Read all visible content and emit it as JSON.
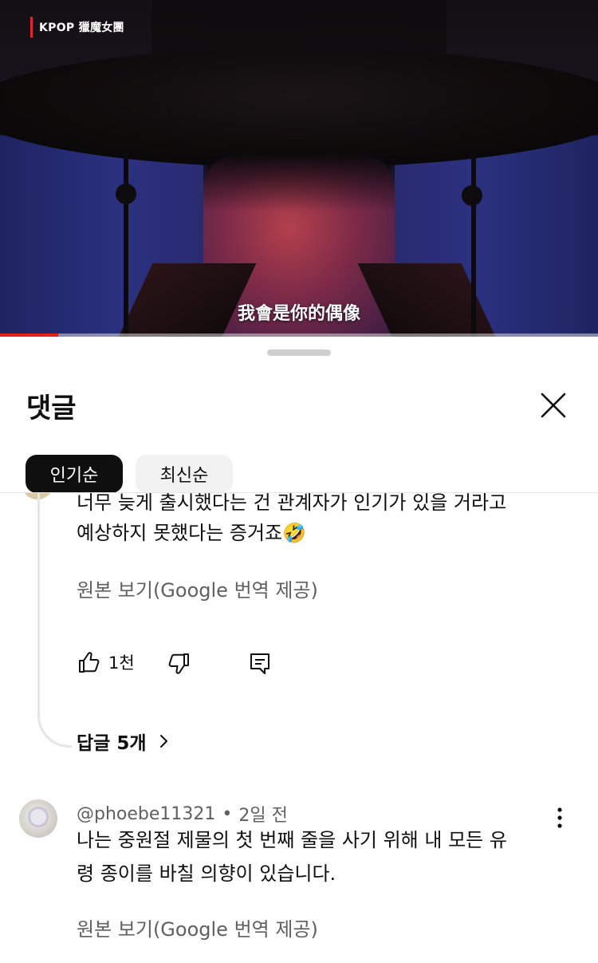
{
  "video": {
    "channel_tag": "KPOP 獵魔女團",
    "subtitle": "我會是你的偶像",
    "progress_fraction": 0.097
  },
  "comments_sheet": {
    "title": "댓글",
    "sort_chips": [
      "인기순",
      "최신순"
    ],
    "selected_sort": "인기순"
  },
  "comment1": {
    "text_line1": "너무 늦게 출시했다는 건 관계자가 인기가 있을 거라고",
    "text_line2": "예상하지 못했다는 증거죠🤣",
    "translate_link": "원본 보기(Google 번역 제공)",
    "like_count": "1천",
    "replies_label": "답글 5개"
  },
  "comment2": {
    "author": "@phoebe11321",
    "separator": "•",
    "time": "2일 전",
    "text_line1": "나는 중원절 제물의 첫 번째 줄을 사기 위해 내 모든 유",
    "text_line2": "령 종이를 바칠 의향이 있습니다.",
    "translate_link": "원본 보기(Google 번역 제공)"
  },
  "icons": {
    "close": "close-icon",
    "like": "thumbs-up-icon",
    "dislike": "thumbs-down-icon",
    "reply": "reply-icon",
    "replies_chevron": "chevron-right-icon",
    "more": "more-vert-icon"
  },
  "colors": {
    "progress": "#e62117",
    "channel_tag_accent": "#e3223a",
    "chip_active_bg": "#0f0f0f",
    "chip_inactive_bg": "#f2f2f2",
    "secondary_text": "#606060"
  }
}
